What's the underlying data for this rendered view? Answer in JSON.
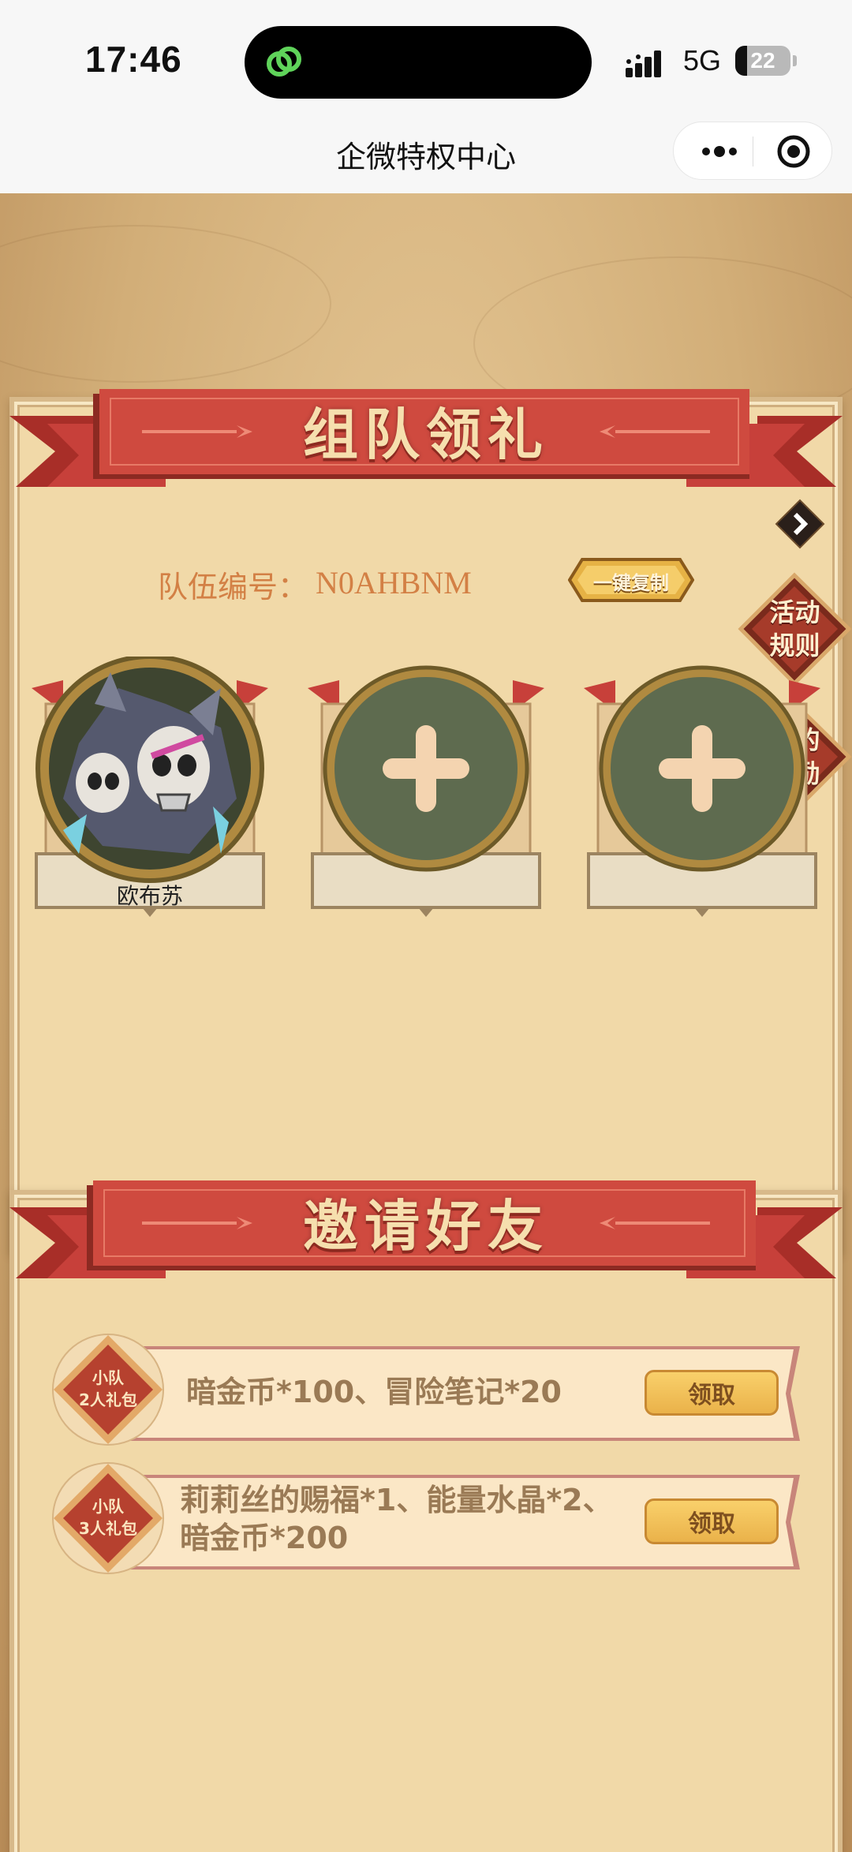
{
  "status_bar": {
    "time": "17:46",
    "network": "5G",
    "battery": "22",
    "battery_fraction": 0.22
  },
  "nav": {
    "title": "企微特权中心",
    "more_icon": "more-dots-icon",
    "close_icon": "target-close-icon"
  },
  "team_section": {
    "title": "组队领礼",
    "team_label": "队伍编号：",
    "team_id": "N0AHBNM",
    "copy_button": "一键复制",
    "members": [
      {
        "name": "欧布苏",
        "filled": true
      },
      {
        "name": "",
        "filled": false
      },
      {
        "name": "",
        "filled": false
      }
    ]
  },
  "side_badges": {
    "rules": [
      "活动",
      "规则"
    ],
    "rewards": [
      "我的",
      "奖励"
    ]
  },
  "invite_section": {
    "title": "邀请好友",
    "rewards": [
      {
        "badge": [
          "小队",
          "2人礼包"
        ],
        "lines": [
          "暗金币*100、冒险笔记*20"
        ],
        "button": "领取"
      },
      {
        "badge": [
          "小队",
          "3人礼包"
        ],
        "lines": [
          "莉莉丝的赐福*1、能量水晶*2、",
          "暗金币*200"
        ],
        "button": "领取"
      }
    ]
  },
  "colors": {
    "ribbon_red": "#c7403a",
    "panel": "#f1d9a8",
    "slot_green": "#5e6b4f",
    "button_gold": "#f3c25c",
    "team_text": "#d38045"
  }
}
